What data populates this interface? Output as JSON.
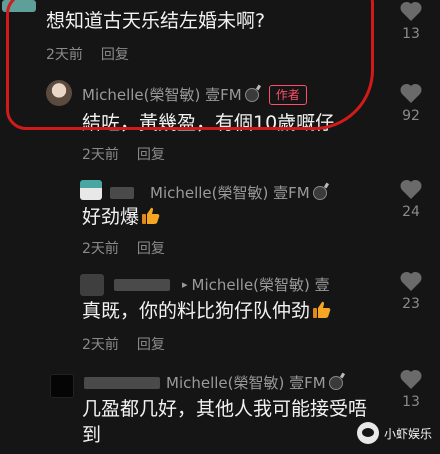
{
  "comments": [
    {
      "text": "想知道古天乐结左婚未啊?",
      "time": "2天前",
      "reply_label": "回复",
      "likes": "13"
    },
    {
      "author": "Michelle(榮智敏) 壹FM",
      "author_tag": "作者",
      "text": "結咗，黃幾盈，有個10歲嘅仔",
      "time": "2天前",
      "reply_label": "回复",
      "likes": "92"
    },
    {
      "reply_to": "Michelle(榮智敏) 壹FM",
      "text": "好劲爆",
      "time": "2天前",
      "reply_label": "回复",
      "likes": "24"
    },
    {
      "reply_to": "Michelle(榮智敏) 壹",
      "text": "真既，你的料比狗仔队仲劲",
      "time": "2天前",
      "reply_label": "回复",
      "likes": "23"
    },
    {
      "reply_to": "Michelle(榮智敏) 壹FM",
      "text": "几盈都几好，其他人我可能接受唔到",
      "likes": "13"
    }
  ],
  "watermark": {
    "text": "小虾娱乐"
  },
  "colors": {
    "highlight": "#d11a1a",
    "author_tag": "#ff4d6a",
    "thumb": "#f5a623"
  }
}
